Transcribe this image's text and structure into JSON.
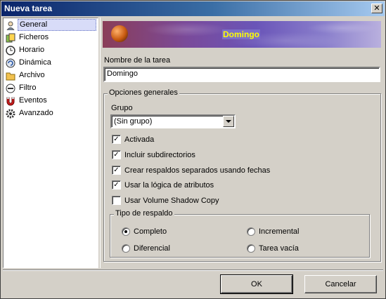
{
  "window": {
    "title": "Nueva tarea",
    "close_label": "✕"
  },
  "sidebar": {
    "items": [
      {
        "label": "General",
        "icon": "person-icon",
        "active": true
      },
      {
        "label": "Ficheros",
        "icon": "files-icon"
      },
      {
        "label": "Horario",
        "icon": "clock-icon"
      },
      {
        "label": "Dinámica",
        "icon": "refresh-icon"
      },
      {
        "label": "Archivo",
        "icon": "folder-icon"
      },
      {
        "label": "Filtro",
        "icon": "filter-icon"
      },
      {
        "label": "Eventos",
        "icon": "magnet-icon"
      },
      {
        "label": "Avanzado",
        "icon": "gear-icon"
      }
    ]
  },
  "banner": {
    "title": "Domingo"
  },
  "task_name": {
    "label": "Nombre de la tarea",
    "value": "Domingo"
  },
  "general_options": {
    "legend": "Opciones generales",
    "group_label": "Grupo",
    "group_value": "(Sin grupo)",
    "checkboxes": [
      {
        "label": "Activada",
        "checked": true
      },
      {
        "label": "Incluir subdirectorios",
        "checked": true
      },
      {
        "label": "Crear respaldos separados usando fechas",
        "checked": true
      },
      {
        "label": "Usar la lógica de atributos",
        "checked": true
      },
      {
        "label": "Usar Volume Shadow Copy",
        "checked": false
      }
    ]
  },
  "backup_type": {
    "legend": "Tipo de respaldo",
    "options": [
      {
        "label": "Completo",
        "selected": true
      },
      {
        "label": "Incremental",
        "selected": false
      },
      {
        "label": "Diferencial",
        "selected": false
      },
      {
        "label": "Tarea vacía",
        "selected": false
      }
    ]
  },
  "buttons": {
    "ok": "OK",
    "cancel": "Cancelar"
  }
}
